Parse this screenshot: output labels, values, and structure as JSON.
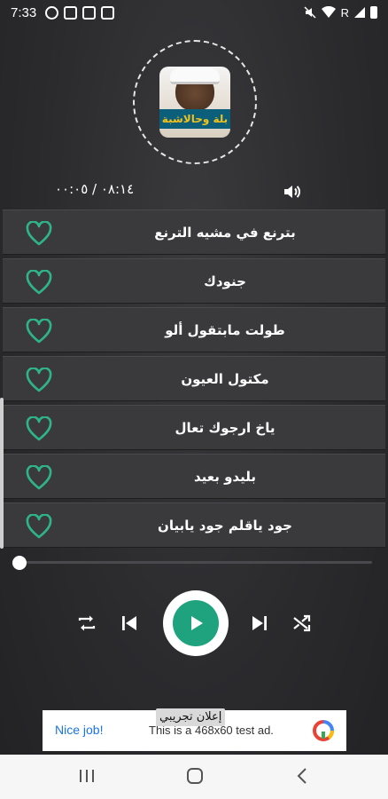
{
  "status_bar": {
    "time": "7:33",
    "signal_label": "R"
  },
  "player": {
    "album_title": "بلة وحالاشبة",
    "time_display": "٠٨:١٤ / ٠٠:٠٥",
    "progress": 0.0
  },
  "playlist": {
    "tracks": [
      {
        "title": "بترنع في مشيه الترنع",
        "favorite": false
      },
      {
        "title": "جنودك",
        "favorite": false
      },
      {
        "title": "طولت مابتقول ألو",
        "favorite": false
      },
      {
        "title": "مكتول العيون",
        "favorite": false
      },
      {
        "title": "ياخ ارجوك تعال",
        "favorite": false
      },
      {
        "title": "بليدو بعيد",
        "favorite": false
      },
      {
        "title": "جود ياقلم جود يابيان",
        "favorite": false
      }
    ]
  },
  "controls": {
    "repeat_icon": "repeat-icon",
    "previous_icon": "skip-previous-icon",
    "play_icon": "play-icon",
    "next_icon": "skip-next-icon",
    "shuffle_icon": "shuffle-icon"
  },
  "ad": {
    "label": "إعلان تجريبي",
    "nice_job": "Nice job!",
    "text": "This is a 468x60 test ad."
  },
  "colors": {
    "accent": "#1fa37e",
    "heart": "#2fb489",
    "background": "#2b2b2e",
    "track_bg": "#3a3a3d"
  }
}
